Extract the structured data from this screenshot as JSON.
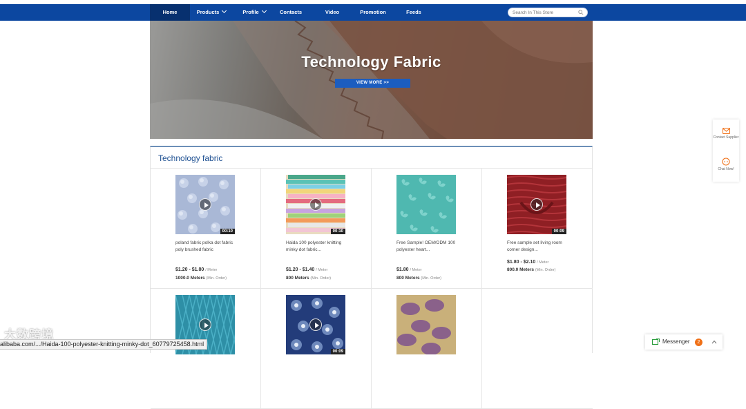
{
  "nav": {
    "items": [
      {
        "label": "Home",
        "active": true,
        "dropdown": false
      },
      {
        "label": "Products",
        "active": false,
        "dropdown": true
      },
      {
        "label": "Profile",
        "active": false,
        "dropdown": true
      },
      {
        "label": "Contacts",
        "active": false,
        "dropdown": false
      },
      {
        "label": "Video",
        "active": false,
        "dropdown": false
      },
      {
        "label": "Promotion",
        "active": false,
        "dropdown": false
      },
      {
        "label": "Feeds",
        "active": false,
        "dropdown": false
      }
    ],
    "search_placeholder": "Search In This Store"
  },
  "hero": {
    "title": "Technology Fabric",
    "button": "VIEW MORE >>"
  },
  "section": {
    "title": "Technology fabric",
    "products": [
      {
        "title": "poland fabric polka dot fabric poly brushed fabric",
        "duration": "00:10",
        "price": "$1.20 - $1.80",
        "price_unit": "/ Meter",
        "moq": "1000.0 Meters",
        "moq_note": "(Min. Order)",
        "thumb": "dots",
        "video": true
      },
      {
        "title": "Haida 100 polyester knitting minky dot fabric...",
        "duration": "00:10",
        "price": "$1.20 - $1.40",
        "price_unit": "/ Meter",
        "moq": "800 Meters",
        "moq_note": "(Min. Order)",
        "thumb": "stack",
        "video": true
      },
      {
        "title": "Free Sample! OEM/ODM 100 polyester heart...",
        "duration": "",
        "price": "$1.80",
        "price_unit": "/ Meter",
        "moq": "800 Meters",
        "moq_note": "(Min. Order)",
        "thumb": "hearts",
        "video": false
      },
      {
        "title": "Free sample set living room corner design...",
        "duration": "00:09",
        "price": "$1.80 - $2.10",
        "price_unit": "/ Meter",
        "moq": "800.0 Meters",
        "moq_note": "(Min. Order)",
        "thumb": "red",
        "video": true
      },
      {
        "title": "",
        "duration": "",
        "price": "",
        "price_unit": "",
        "moq": "",
        "moq_note": "",
        "thumb": "quilt",
        "video": true
      },
      {
        "title": "",
        "duration": "00:09",
        "price": "",
        "price_unit": "",
        "moq": "",
        "moq_note": "",
        "thumb": "floral",
        "video": true
      },
      {
        "title": "",
        "duration": "",
        "price": "",
        "price_unit": "",
        "moq": "",
        "moq_note": "",
        "thumb": "purple",
        "video": false
      }
    ]
  },
  "side": {
    "contact_label": "Contact Supplier",
    "chat_label": "Chat Now!"
  },
  "messenger": {
    "label": "Messenger",
    "count": "2"
  },
  "status_url": "alibaba.com/.../Haida-100-polyester-knitting-minky-dot_60779725458.html",
  "watermark": "大数跨境",
  "colors": {
    "nav_bg": "#0c47a0",
    "nav_active": "#07306f",
    "accent": "#1d4f91",
    "badge": "#f07017"
  }
}
